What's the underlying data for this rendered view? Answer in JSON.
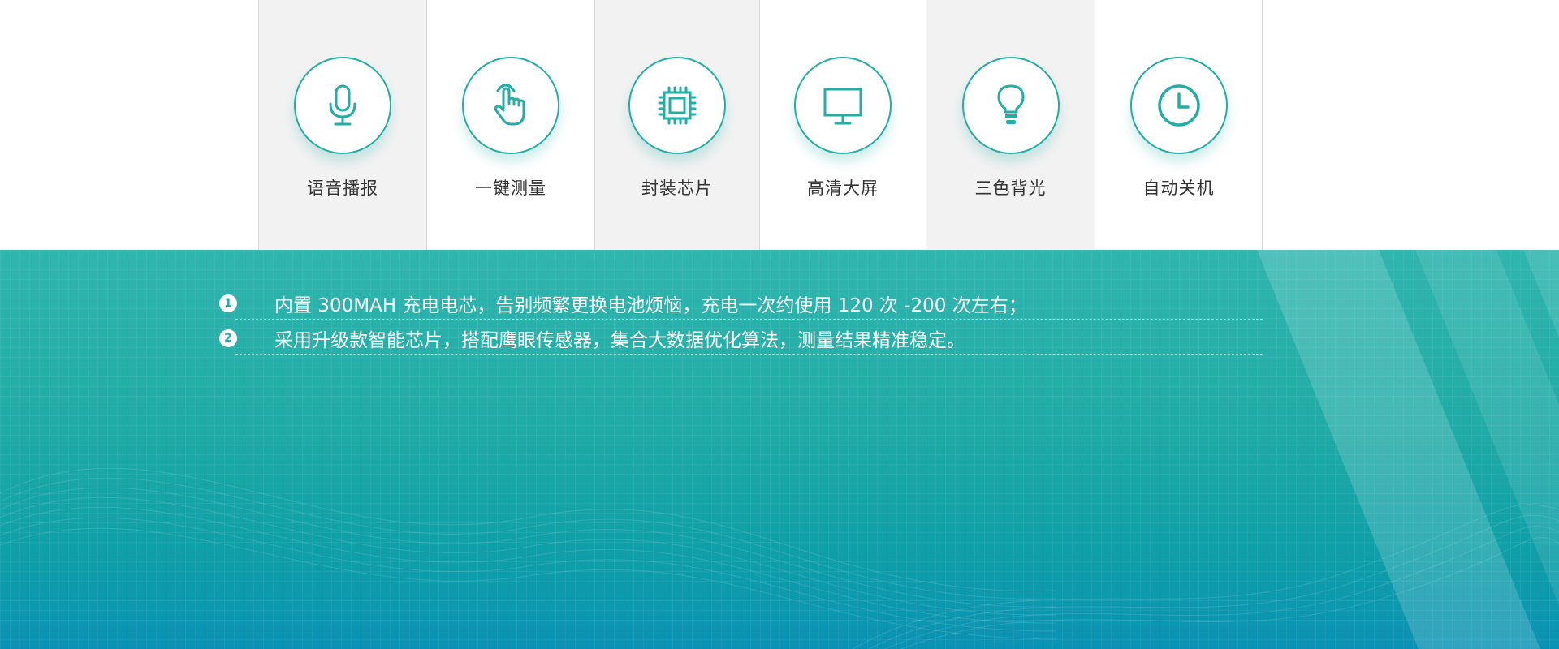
{
  "features": [
    {
      "label": "语音播报",
      "icon": "microphone-icon",
      "shaded": true
    },
    {
      "label": "一键测量",
      "icon": "finger-tap-icon",
      "shaded": false
    },
    {
      "label": "封装芯片",
      "icon": "chip-icon",
      "shaded": true
    },
    {
      "label": "高清大屏",
      "icon": "monitor-icon",
      "shaded": false
    },
    {
      "label": "三色背光",
      "icon": "light-bulb-icon",
      "shaded": true
    },
    {
      "label": "自动关机",
      "icon": "clock-icon",
      "shaded": false
    }
  ],
  "notes": [
    {
      "number": "1",
      "text": "内置 300MAH 充电电芯，告别频繁更换电池烦恼，充电一次约使用 120 次 -200 次左右；"
    },
    {
      "number": "2",
      "text": "采用升级款智能芯片，搭配鹰眼传感器，集合大数据优化算法，测量结果精准稳定。"
    }
  ],
  "colors": {
    "accent": "#22aea4",
    "teal_background": "#1faba6",
    "label_text": "#333333",
    "shaded_cell": "#f2f2f2"
  }
}
